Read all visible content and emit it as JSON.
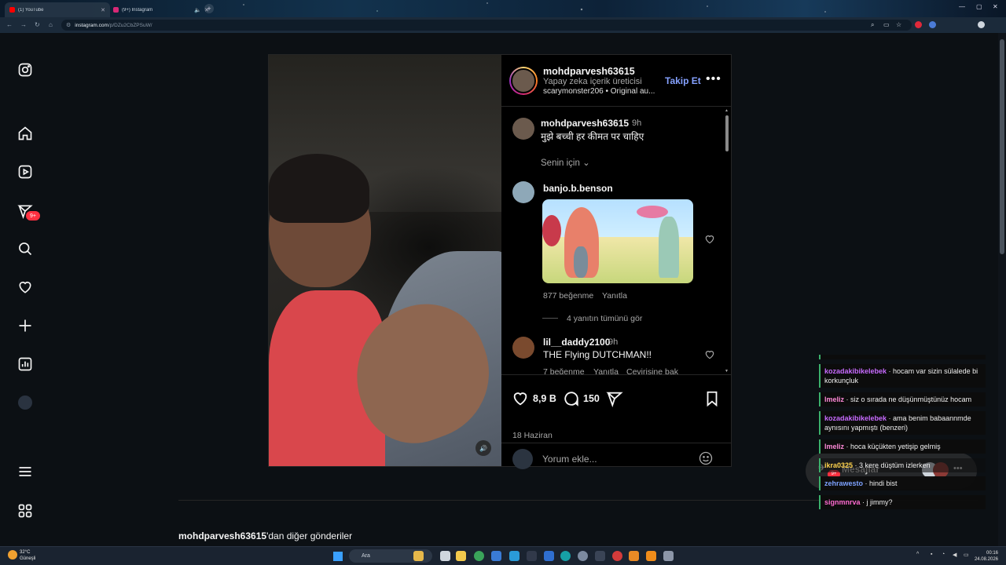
{
  "browser": {
    "tabs": [
      {
        "label": "(1) YouTube",
        "active": true,
        "favicon_color": "#ff0000"
      },
      {
        "label": "(9+) Instagram",
        "active": false,
        "favicon_color": "#d62976"
      }
    ],
    "url_host": "instagram.com",
    "url_path": "/p/DZu2CbZPSuW/"
  },
  "sidebar": {
    "notification_badge": "9+",
    "items": [
      "instagram-logo",
      "home",
      "reels",
      "direct-messages",
      "search",
      "notifications",
      "create",
      "dashboard",
      "profile",
      "more",
      "also-from-meta"
    ]
  },
  "post": {
    "username": "mohdparvesh63615",
    "subtitle": "Yapay zeka içerik üreticisi",
    "audio": "scarymonster206 • Original au...",
    "follow_label": "Takip Et",
    "caption_user": "mohdparvesh63615",
    "caption_time": "9h",
    "caption_text": "मुझे बच्ची हर कीमत पर चाहिए",
    "for_you_label": "Senin için",
    "comments": [
      {
        "user": "banjo.b.benson",
        "likes": "877 beğenme",
        "reply": "Yanıtla",
        "view_replies": "4 yanıtın tümünü gör"
      },
      {
        "user": "lil__daddy2100",
        "time": "9h",
        "text": "THE Flying DUTCHMAN!!",
        "likes": "7 beğenme",
        "reply": "Yanıtla",
        "translate": "Çevirisine bak"
      }
    ],
    "like_count": "8,9 B",
    "comment_count": "150",
    "date": "18 Haziran",
    "add_comment_placeholder": "Yorum ekle..."
  },
  "more_posts": {
    "user": "mohdparvesh63615",
    "suffix": "'dan diğer gönderiler"
  },
  "chat": {
    "messages": [
      {
        "user": "kozadakibikelebek",
        "text": "hocam var sizin sülalede bi korkunçluk",
        "color": "#c86bff"
      },
      {
        "user": "lmeliz",
        "text": "siz o sırada ne düşünmüştünüz hocam",
        "color": "#ff8ad8"
      },
      {
        "user": "kozadakibikelebek",
        "text": "ama benim babaannmde aynısını yapmıştı (benzeri)",
        "color": "#c86bff"
      },
      {
        "user": "lmeliz",
        "text": "hoca küçükten yetişip gelmiş",
        "color": "#ff8ad8"
      },
      {
        "user": "ikra0325",
        "text": "3 kere düştüm izlerken",
        "color": "#ffd34d"
      },
      {
        "user": "zehrawesto",
        "text": "hindi bist",
        "color": "#7ea2ff"
      },
      {
        "user": "signmnrva",
        "text": "j jimmy?",
        "color": "#ff6bd0"
      }
    ],
    "messages_label": "Mesajlar",
    "messages_badge": "9+"
  },
  "taskbar": {
    "temperature": "32°C",
    "weather": "Güneşli",
    "search_label": "Ara",
    "time": "00:16",
    "date": "24.08.2026"
  }
}
